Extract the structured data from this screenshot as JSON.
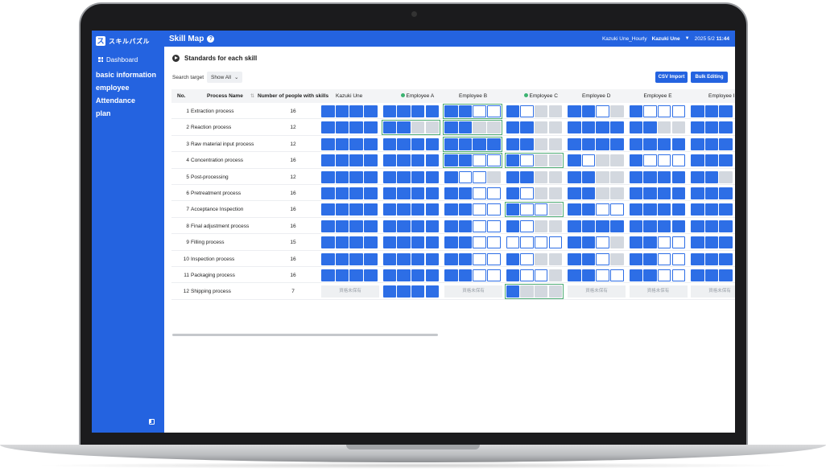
{
  "app": {
    "logo_text": "スキルパズル",
    "logo_glyph": "ス"
  },
  "sidebar": {
    "dashboard": "Dashboard",
    "items": [
      {
        "label": "basic information"
      },
      {
        "label": "employee"
      },
      {
        "label": "Attendance"
      },
      {
        "label": "plan"
      }
    ]
  },
  "header": {
    "title": "Skill Map",
    "account": "Kazuki Une_Hourly",
    "user": "Kazuki Une",
    "date": "2025 5/2",
    "time": "11:44"
  },
  "section": {
    "title": "Standards for each skill"
  },
  "search": {
    "label": "Search target",
    "value": "Show All"
  },
  "buttons": {
    "csv_import": "CSV Import",
    "bulk_editing": "Bulk Editing"
  },
  "table": {
    "headers": {
      "no": "No.",
      "process_name": "Process Name",
      "count": "Number of people with skills"
    },
    "employees": [
      {
        "name": "Kazuki Une",
        "dot": false
      },
      {
        "name": "Employee A",
        "dot": true
      },
      {
        "name": "Employee B",
        "dot": false
      },
      {
        "name": "Employee C",
        "dot": true
      },
      {
        "name": "Employee D",
        "dot": false
      },
      {
        "name": "Employee E",
        "dot": false
      },
      {
        "name": "Employee I",
        "dot": false
      }
    ],
    "not_qualified_text": "資格未保有",
    "rows": [
      {
        "no": "1",
        "name": "Extraction process",
        "count": "16",
        "cells": [
          "ffff",
          "ffff",
          "ffhh",
          "fhee",
          "ffhe",
          "fhhh",
          "fff"
        ],
        "hl": [
          false,
          false,
          true,
          false,
          false,
          false,
          false
        ]
      },
      {
        "no": "2",
        "name": "Reaction process",
        "count": "12",
        "cells": [
          "ffff",
          "ffee",
          "ffee",
          "ffee",
          "ffff",
          "ffee",
          "fff"
        ],
        "hl": [
          false,
          true,
          true,
          false,
          false,
          false,
          false
        ]
      },
      {
        "no": "3",
        "name": "Raw material input process",
        "count": "12",
        "cells": [
          "ffff",
          "ffff",
          "ffff",
          "ffee",
          "ffff",
          "ffff",
          "fff"
        ],
        "hl": [
          false,
          false,
          true,
          false,
          false,
          false,
          false
        ]
      },
      {
        "no": "4",
        "name": "Concentration process",
        "count": "16",
        "cells": [
          "ffff",
          "ffff",
          "ffhh",
          "fhee",
          "fhee",
          "fhhh",
          "fff"
        ],
        "hl": [
          false,
          false,
          true,
          true,
          false,
          false,
          false
        ]
      },
      {
        "no": "5",
        "name": "Post-processing",
        "count": "12",
        "cells": [
          "ffff",
          "ffff",
          "fhhe",
          "ffee",
          "ffee",
          "ffff",
          "ffe"
        ],
        "hl": [
          false,
          false,
          false,
          false,
          false,
          false,
          false
        ]
      },
      {
        "no": "6",
        "name": "Pretreatment process",
        "count": "16",
        "cells": [
          "ffff",
          "ffff",
          "ffhh",
          "fhee",
          "ffee",
          "ffff",
          "fff"
        ],
        "hl": [
          false,
          false,
          false,
          false,
          false,
          false,
          false
        ]
      },
      {
        "no": "7",
        "name": "Acceptance Inspection",
        "count": "16",
        "cells": [
          "ffff",
          "ffff",
          "ffhh",
          "fhhe",
          "ffhh",
          "ffff",
          "fff"
        ],
        "hl": [
          false,
          false,
          false,
          true,
          false,
          false,
          false
        ]
      },
      {
        "no": "8",
        "name": "Final adjustment process",
        "count": "16",
        "cells": [
          "ffff",
          "ffff",
          "ffhh",
          "fhee",
          "ffff",
          "ffff",
          "fff"
        ],
        "hl": [
          false,
          false,
          false,
          false,
          false,
          false,
          false
        ]
      },
      {
        "no": "9",
        "name": "Filling process",
        "count": "15",
        "cells": [
          "ffff",
          "ffff",
          "ffhh",
          "hhhh",
          "ffhe",
          "ffhh",
          "fff"
        ],
        "hl": [
          false,
          false,
          false,
          false,
          false,
          false,
          false
        ]
      },
      {
        "no": "10",
        "name": "Inspection process",
        "count": "16",
        "cells": [
          "ffff",
          "ffff",
          "ffhh",
          "fhee",
          "ffhe",
          "ffhh",
          "fff"
        ],
        "hl": [
          false,
          false,
          false,
          false,
          false,
          false,
          false
        ]
      },
      {
        "no": "11",
        "name": "Packaging process",
        "count": "16",
        "cells": [
          "ffff",
          "ffff",
          "ffhh",
          "fhhe",
          "ffhh",
          "ffhh",
          "fff"
        ],
        "hl": [
          false,
          false,
          false,
          false,
          false,
          false,
          false
        ]
      },
      {
        "no": "12",
        "name": "Shipping process",
        "count": "7",
        "cells": [
          "x",
          "ffff",
          "x",
          "feee",
          "x",
          "x",
          "x"
        ],
        "hl": [
          false,
          false,
          false,
          true,
          false,
          false,
          false
        ]
      }
    ]
  }
}
